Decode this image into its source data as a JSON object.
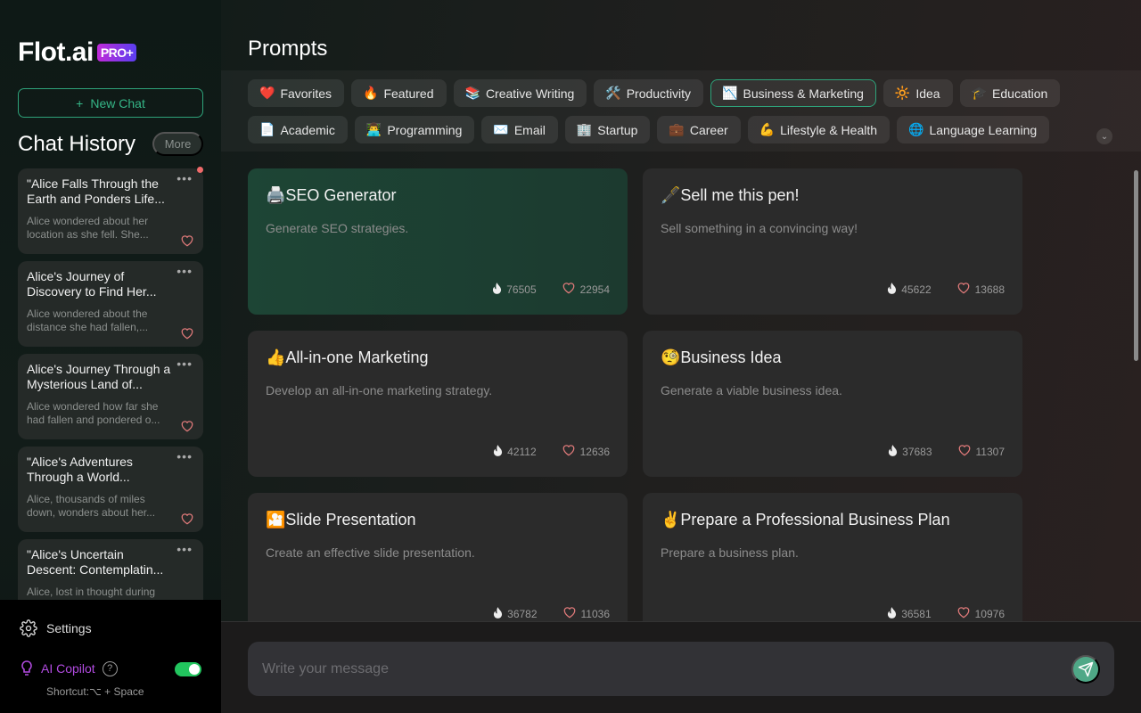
{
  "sidebar": {
    "logo": "Flot.ai",
    "badge": "PRO+",
    "new_chat": "New Chat",
    "history_title": "Chat History",
    "more": "More",
    "chats": [
      {
        "title": "\"Alice Falls Through the Earth and Ponders Life...",
        "preview": "Alice wondered about her location as she fell. She...",
        "unread": true
      },
      {
        "title": "Alice's Journey of Discovery to Find Her...",
        "preview": "Alice wondered about the distance she had fallen,..."
      },
      {
        "title": "Alice's Journey Through a Mysterious Land of...",
        "preview": "Alice wondered how far she had fallen and pondered o..."
      },
      {
        "title": "\"Alice's Adventures Through a World...",
        "preview": "Alice, thousands of miles down, wonders about her..."
      },
      {
        "title": "\"Alice's Uncertain Descent: Contemplatin...",
        "preview": "Alice, lost in thought during"
      }
    ],
    "settings": "Settings",
    "copilot": "AI Copilot",
    "copilot_enabled": true,
    "shortcut": "Shortcut:⌥ + Space"
  },
  "main": {
    "title": "Prompts",
    "categories": [
      {
        "icon": "❤️",
        "label": "Favorites"
      },
      {
        "icon": "🔥",
        "label": "Featured"
      },
      {
        "icon": "📚",
        "label": "Creative Writing"
      },
      {
        "icon": "🛠️",
        "label": "Productivity"
      },
      {
        "icon": "📉",
        "label": "Business & Marketing",
        "active": true
      },
      {
        "icon": "🔆",
        "label": "Idea"
      },
      {
        "icon": "🎓",
        "label": "Education"
      },
      {
        "icon": "📄",
        "label": "Academic"
      },
      {
        "icon": "👨‍💻",
        "label": "Programming"
      },
      {
        "icon": "✉️",
        "label": "Email"
      },
      {
        "icon": "🏢",
        "label": "Startup"
      },
      {
        "icon": "💼",
        "label": "Career"
      },
      {
        "icon": "💪",
        "label": "Lifestyle & Health"
      },
      {
        "icon": "🌐",
        "label": "Language Learning"
      }
    ],
    "prompts": [
      {
        "title": "🖨️SEO Generator",
        "desc": "Generate SEO strategies.",
        "uses": "76505",
        "likes": "22954"
      },
      {
        "title": "🖋️Sell me this pen!",
        "desc": "Sell something in a convincing way!",
        "uses": "45622",
        "likes": "13688"
      },
      {
        "title": "👍All-in-one Marketing",
        "desc": "Develop an all-in-one marketing strategy.",
        "uses": "42112",
        "likes": "12636"
      },
      {
        "title": "🧐Business Idea",
        "desc": "Generate a viable business idea.",
        "uses": "37683",
        "likes": "11307"
      },
      {
        "title": "🎦Slide Presentation",
        "desc": "Create an effective slide presentation.",
        "uses": "36782",
        "likes": "11036"
      },
      {
        "title": "✌️Prepare a Professional Business Plan",
        "desc": "Prepare a business plan.",
        "uses": "36581",
        "likes": "10976"
      }
    ],
    "input_placeholder": "Write your message"
  },
  "colors": {
    "accent": "#2ea37a",
    "heart": "#e07a7a",
    "toggle": "#22c55e",
    "copilot": "#b14be0"
  }
}
